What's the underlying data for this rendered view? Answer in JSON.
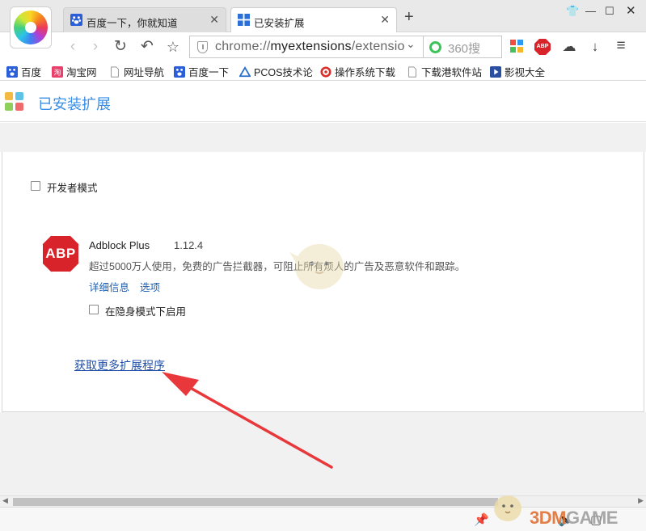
{
  "tabs": [
    {
      "title": "百度一下，你就知道",
      "active": false,
      "icon": "baidu-paw-icon"
    },
    {
      "title": "已安装扩展",
      "active": true,
      "icon": "extensions-icon"
    }
  ],
  "toolbar": {
    "url_prefix": "chrome://",
    "url_host": "myextensions",
    "url_rest": "/extensio",
    "search_placeholder": "360搜"
  },
  "bookmarks": [
    {
      "label": "百度",
      "icon": "baidu-paw-icon"
    },
    {
      "label": "淘宝网",
      "icon": "taobao-icon"
    },
    {
      "label": "网址导航",
      "icon": "page-icon"
    },
    {
      "label": "百度一下",
      "icon": "baidu-paw-icon"
    },
    {
      "label": "PCOS技术论",
      "icon": "pcos-icon"
    },
    {
      "label": "操作系统下载",
      "icon": "swirl-icon"
    },
    {
      "label": "下载港软件站",
      "icon": "page-icon"
    },
    {
      "label": "影视大全",
      "icon": "video-icon"
    }
  ],
  "page": {
    "title": "已安装扩展",
    "developer_mode_label": "开发者模式",
    "developer_mode_checked": false,
    "get_more_link": "获取更多扩展程序"
  },
  "extension": {
    "name": "Adblock Plus",
    "version": "1.12.4",
    "icon_text": "ABP",
    "description": "超过5000万人使用，免费的广告拦截器，可阻止所有烦人的广告及恶意软件和跟踪。",
    "details_link": "详细信息",
    "options_link": "选项",
    "incognito_label": "在隐身模式下启用",
    "incognito_checked": false
  },
  "toolbar_icons": {
    "abp_badge": "ABP"
  },
  "watermark": {
    "text_main": "3DM",
    "text_gray": "GAME"
  },
  "colors": {
    "accent": "#3a8ee6",
    "link": "#2060b0",
    "abp_red": "#d8232a",
    "arrow_red": "#e8383b"
  }
}
